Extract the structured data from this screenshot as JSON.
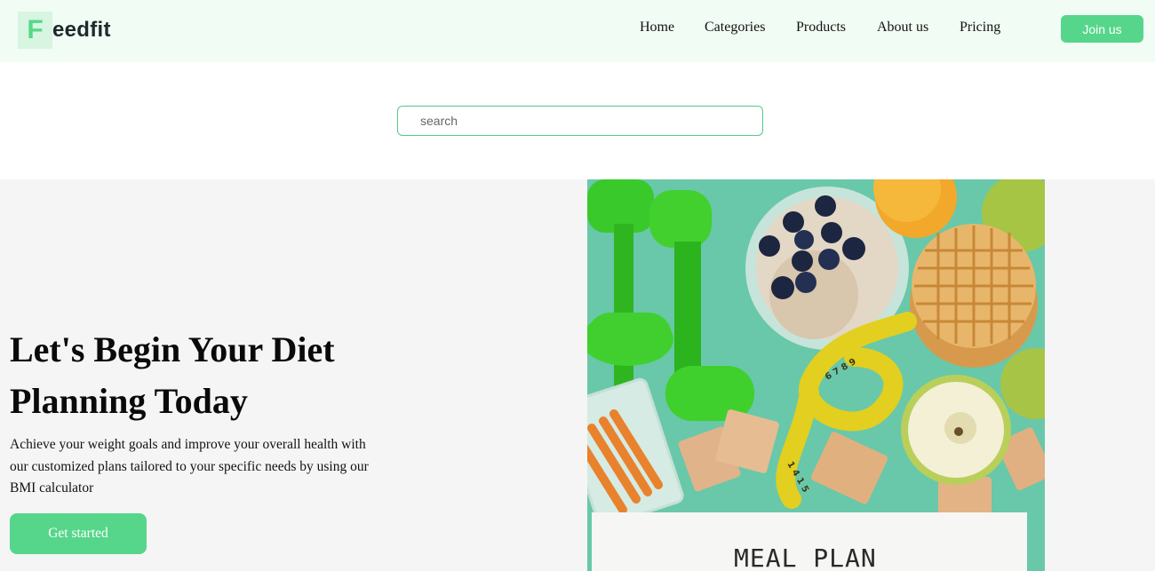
{
  "brand": {
    "logo_letter": "F",
    "logo_rest": "eedfit",
    "accent": "#56d68b",
    "header_bg": "#f1fcf5"
  },
  "nav": {
    "items": [
      {
        "label": "Home"
      },
      {
        "label": "Categories"
      },
      {
        "label": "Products"
      },
      {
        "label": "About us"
      },
      {
        "label": "Pricing"
      }
    ],
    "join_label": "Join us"
  },
  "search": {
    "placeholder": "search",
    "value": ""
  },
  "hero": {
    "title_line1": "Let's Begin Your Diet",
    "title_line2": "Planning Today",
    "description": "Achieve your weight goals and improve your overall health with our customized plans tailored to your specific needs by using our BMI calculator",
    "cta_label": "Get started",
    "image_caption": "MEAL PLAN",
    "bg": "#f5f5f5"
  }
}
